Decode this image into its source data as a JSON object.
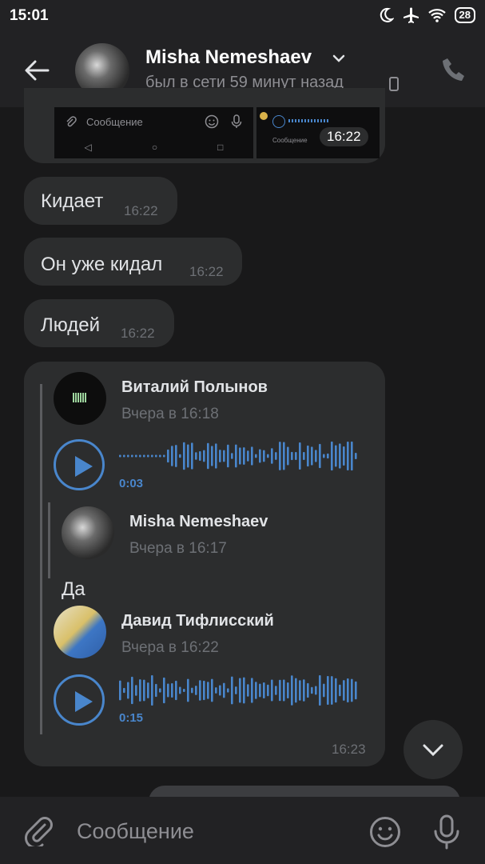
{
  "status_bar": {
    "time": "15:01",
    "battery": "28"
  },
  "header": {
    "name": "Misha Nemeshaev",
    "status": "был в сети 59 минут назад"
  },
  "attachment": {
    "preview_input_placeholder": "Сообщение",
    "time": "16:22"
  },
  "messages": [
    {
      "text": "Кидает",
      "time": "16:22"
    },
    {
      "text": "Он уже кидал",
      "time": "16:22"
    },
    {
      "text": "Людей",
      "time": "16:22"
    }
  ],
  "forwarded": {
    "time": "16:23",
    "items": [
      {
        "author": "Виталий Полынов",
        "date": "Вчера в 16:18",
        "duration": "0:03"
      },
      {
        "author": "Misha Nemeshaev",
        "date": "Вчера в 16:17",
        "text": "Да"
      },
      {
        "author": "Давид Тифлисский",
        "date": "Вчера в 16:22",
        "duration": "0:15"
      }
    ]
  },
  "input": {
    "placeholder": "Сообщение"
  },
  "colors": {
    "accent": "#4986cc",
    "bubble": "#2c2d2e",
    "background": "#19191a",
    "bar": "#222224"
  },
  "icons": [
    "moon-icon",
    "airplane-icon",
    "wifi-icon",
    "back-arrow-icon",
    "chevron-down-icon",
    "phone-icon",
    "play-icon",
    "attach-icon",
    "emoji-icon",
    "mic-icon"
  ]
}
